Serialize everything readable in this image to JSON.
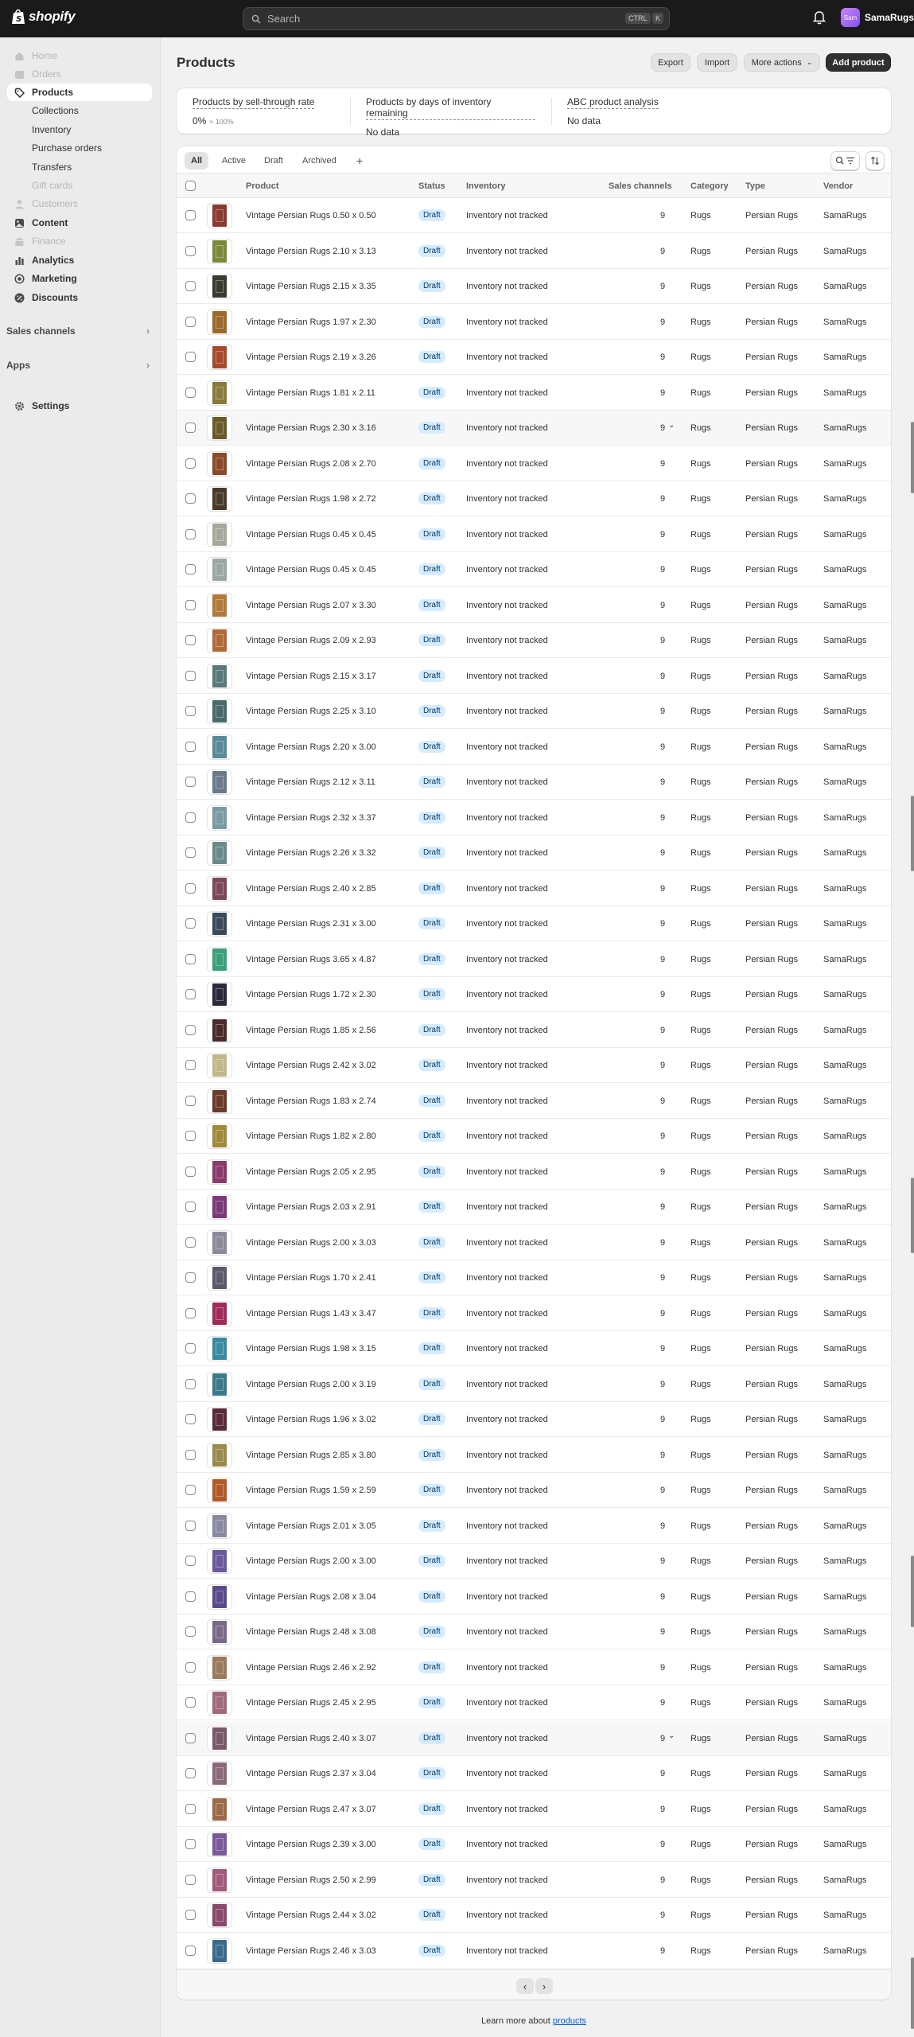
{
  "topbar": {
    "logo_text": "shopify",
    "search_placeholder": "Search",
    "kbd_ctrl": "CTRL",
    "kbd_k": "K",
    "store_initials": "Sam",
    "store_name": "SamaRugs"
  },
  "sidebar": {
    "items": [
      {
        "label": "Home",
        "state": "dim"
      },
      {
        "label": "Orders",
        "state": "dim"
      },
      {
        "label": "Products",
        "state": "active"
      },
      {
        "label": "Collections",
        "state": "sub"
      },
      {
        "label": "Inventory",
        "state": "sub"
      },
      {
        "label": "Purchase orders",
        "state": "sub"
      },
      {
        "label": "Transfers",
        "state": "sub"
      },
      {
        "label": "Gift cards",
        "state": "subdim"
      },
      {
        "label": "Customers",
        "state": "dim"
      },
      {
        "label": "Content",
        "state": "bold"
      },
      {
        "label": "Finance",
        "state": "dim"
      },
      {
        "label": "Analytics",
        "state": "bold"
      },
      {
        "label": "Marketing",
        "state": "bold"
      },
      {
        "label": "Discounts",
        "state": "bold"
      }
    ],
    "sales_channels": "Sales channels",
    "apps": "Apps",
    "settings": "Settings"
  },
  "page": {
    "title": "Products",
    "export": "Export",
    "import": "Import",
    "more_actions": "More actions",
    "add_product": "Add product"
  },
  "metrics": [
    {
      "title": "Products by sell-through rate",
      "value": "0%",
      "note": "≈ 100%"
    },
    {
      "title": "Products by days of inventory remaining",
      "value": "No data",
      "note": ""
    },
    {
      "title": "ABC product analysis",
      "value": "No data",
      "note": ""
    }
  ],
  "tabs": [
    "All",
    "Active",
    "Draft",
    "Archived"
  ],
  "add_tab": "+",
  "columns": {
    "product": "Product",
    "status": "Status",
    "inventory": "Inventory",
    "sales_channels": "Sales channels",
    "category": "Category",
    "type": "Type",
    "vendor": "Vendor"
  },
  "row_defaults": {
    "status": "Draft",
    "inventory": "Inventory not tracked",
    "channels": "9",
    "category": "Rugs",
    "type": "Persian Rugs",
    "vendor": "SamaRugs"
  },
  "rows": [
    {
      "name": "Vintage Persian Rugs 0.50 x 0.50",
      "color": "#8a3a32"
    },
    {
      "name": "Vintage Persian Rugs 2.10 x 3.13",
      "color": "#7a8a3a"
    },
    {
      "name": "Vintage Persian Rugs 2.15 x 3.35",
      "color": "#3a3a2e"
    },
    {
      "name": "Vintage Persian Rugs 1.97 x 2.30",
      "color": "#9a6a2a"
    },
    {
      "name": "Vintage Persian Rugs 2.19 x 3.26",
      "color": "#a64a2e"
    },
    {
      "name": "Vintage Persian Rugs 1.81 x 2.11",
      "color": "#8a7a3a"
    },
    {
      "name": "Vintage Persian Rugs 2.30 x 3.16",
      "color": "#6a5a2a",
      "hover": true
    },
    {
      "name": "Vintage Persian Rugs 2.08 x 2.70",
      "color": "#8a4a2a"
    },
    {
      "name": "Vintage Persian Rugs 1.98 x 2.72",
      "color": "#4a3a2a"
    },
    {
      "name": "Vintage Persian Rugs 0.45 x 0.45",
      "color": "#a8a89a"
    },
    {
      "name": "Vintage Persian Rugs 0.45 x 0.45",
      "color": "#9aa8a4"
    },
    {
      "name": "Vintage Persian Rugs 2.07 x 3.30",
      "color": "#b07a3a"
    },
    {
      "name": "Vintage Persian Rugs 2.09 x 2.93",
      "color": "#b06a3a"
    },
    {
      "name": "Vintage Persian Rugs 2.15 x 3.17",
      "color": "#5a7a7a"
    },
    {
      "name": "Vintage Persian Rugs 2.25 x 3.10",
      "color": "#4a6a6a"
    },
    {
      "name": "Vintage Persian Rugs 2.20 x 3.00",
      "color": "#5a8a9a"
    },
    {
      "name": "Vintage Persian Rugs 2.12 x 3.11",
      "color": "#6a7a8a"
    },
    {
      "name": "Vintage Persian Rugs 2.32 x 3.37",
      "color": "#7a9aa4"
    },
    {
      "name": "Vintage Persian Rugs 2.26 x 3.32",
      "color": "#6a8a8a"
    },
    {
      "name": "Vintage Persian Rugs 2.40 x 2.85",
      "color": "#7a4a5a"
    },
    {
      "name": "Vintage Persian Rugs 2.31 x 3.00",
      "color": "#3a4a5a"
    },
    {
      "name": "Vintage Persian Rugs 3.65 x 4.87",
      "color": "#3aa07a"
    },
    {
      "name": "Vintage Persian Rugs 1.72 x 2.30",
      "color": "#2a2a3a"
    },
    {
      "name": "Vintage Persian Rugs 1.85 x 2.56",
      "color": "#4a2a2a"
    },
    {
      "name": "Vintage Persian Rugs 2.42 x 3.02",
      "color": "#c0b88a"
    },
    {
      "name": "Vintage Persian Rugs 1.83 x 2.74",
      "color": "#6a3a2a"
    },
    {
      "name": "Vintage Persian Rugs 1.82 x 2.80",
      "color": "#a08a3a"
    },
    {
      "name": "Vintage Persian Rugs 2.05 x 2.95",
      "color": "#8a3a6a"
    },
    {
      "name": "Vintage Persian Rugs 2.03 x 2.91",
      "color": "#7a3a7a"
    },
    {
      "name": "Vintage Persian Rugs 2.00 x 3.03",
      "color": "#8a8a9a"
    },
    {
      "name": "Vintage Persian Rugs 1.70 x 2.41",
      "color": "#5a5a6a"
    },
    {
      "name": "Vintage Persian Rugs 1.43 x 3.47",
      "color": "#a02a5a"
    },
    {
      "name": "Vintage Persian Rugs 1.98 x 3.15",
      "color": "#3a8aa0"
    },
    {
      "name": "Vintage Persian Rugs 2.00 x 3.19",
      "color": "#3a7a8a"
    },
    {
      "name": "Vintage Persian Rugs 1.96 x 3.02",
      "color": "#5a2a3a"
    },
    {
      "name": "Vintage Persian Rugs 2.85 x 3.80",
      "color": "#9a8a4a"
    },
    {
      "name": "Vintage Persian Rugs 1.59 x 2.59",
      "color": "#b05a2a"
    },
    {
      "name": "Vintage Persian Rugs 2.01 x 3.05",
      "color": "#8a8aa0"
    },
    {
      "name": "Vintage Persian Rugs 2.00 x 3.00",
      "color": "#6a5a9a"
    },
    {
      "name": "Vintage Persian Rugs 2.08 x 3.04",
      "color": "#5a4a8a"
    },
    {
      "name": "Vintage Persian Rugs 2.48 x 3.08",
      "color": "#7a6a8a"
    },
    {
      "name": "Vintage Persian Rugs 2.46 x 2.92",
      "color": "#9a7a5a"
    },
    {
      "name": "Vintage Persian Rugs 2.45 x 2.95",
      "color": "#a06a7a"
    },
    {
      "name": "Vintage Persian Rugs 2.40 x 3.07",
      "color": "#7a5a6a",
      "hover": true
    },
    {
      "name": "Vintage Persian Rugs 2.37 x 3.04",
      "color": "#8a6a7a"
    },
    {
      "name": "Vintage Persian Rugs 2.47 x 3.07",
      "color": "#9a6a4a"
    },
    {
      "name": "Vintage Persian Rugs 2.39 x 3.00",
      "color": "#7a5a9a"
    },
    {
      "name": "Vintage Persian Rugs 2.50 x 2.99",
      "color": "#a05a7a"
    },
    {
      "name": "Vintage Persian Rugs 2.44 x 3.02",
      "color": "#8a4a6a"
    },
    {
      "name": "Vintage Persian Rugs 2.46 x 3.03",
      "color": "#3a6a8a"
    }
  ],
  "footer": {
    "learn_prefix": "Learn more about ",
    "learn_link": "products"
  }
}
